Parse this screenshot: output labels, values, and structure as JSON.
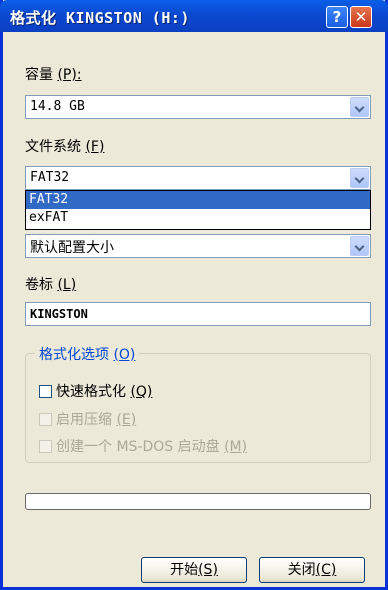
{
  "window": {
    "title": "格式化 KINGSTON (H:)",
    "help_glyph": "?",
    "close_glyph": "✕"
  },
  "capacity": {
    "label": "容量",
    "hotkey": "(P):",
    "value": "14.8 GB"
  },
  "filesystem": {
    "label": "文件系统",
    "hotkey": "(F)",
    "value": "FAT32",
    "options": [
      "FAT32",
      "exFAT"
    ]
  },
  "allocation": {
    "value": "默认配置大小"
  },
  "volume": {
    "label": "卷标",
    "hotkey": "(L)",
    "value": "KINGSTON"
  },
  "format_options": {
    "title": "格式化选项",
    "hotkey": "(O)",
    "quick": {
      "label": "快速格式化",
      "hotkey": "(Q)"
    },
    "compress": {
      "label": "启用压缩",
      "hotkey": "(E)"
    },
    "msdos": {
      "label": "创建一个 MS-DOS 启动盘",
      "hotkey": "(M)"
    }
  },
  "buttons": {
    "start": {
      "label": "开始",
      "hotkey": "(S)"
    },
    "close": {
      "label": "关闭",
      "hotkey": "(C)"
    }
  },
  "colors": {
    "title_bar": "#0a5ee8",
    "selection": "#316ac5",
    "group_title": "#0046d5"
  }
}
